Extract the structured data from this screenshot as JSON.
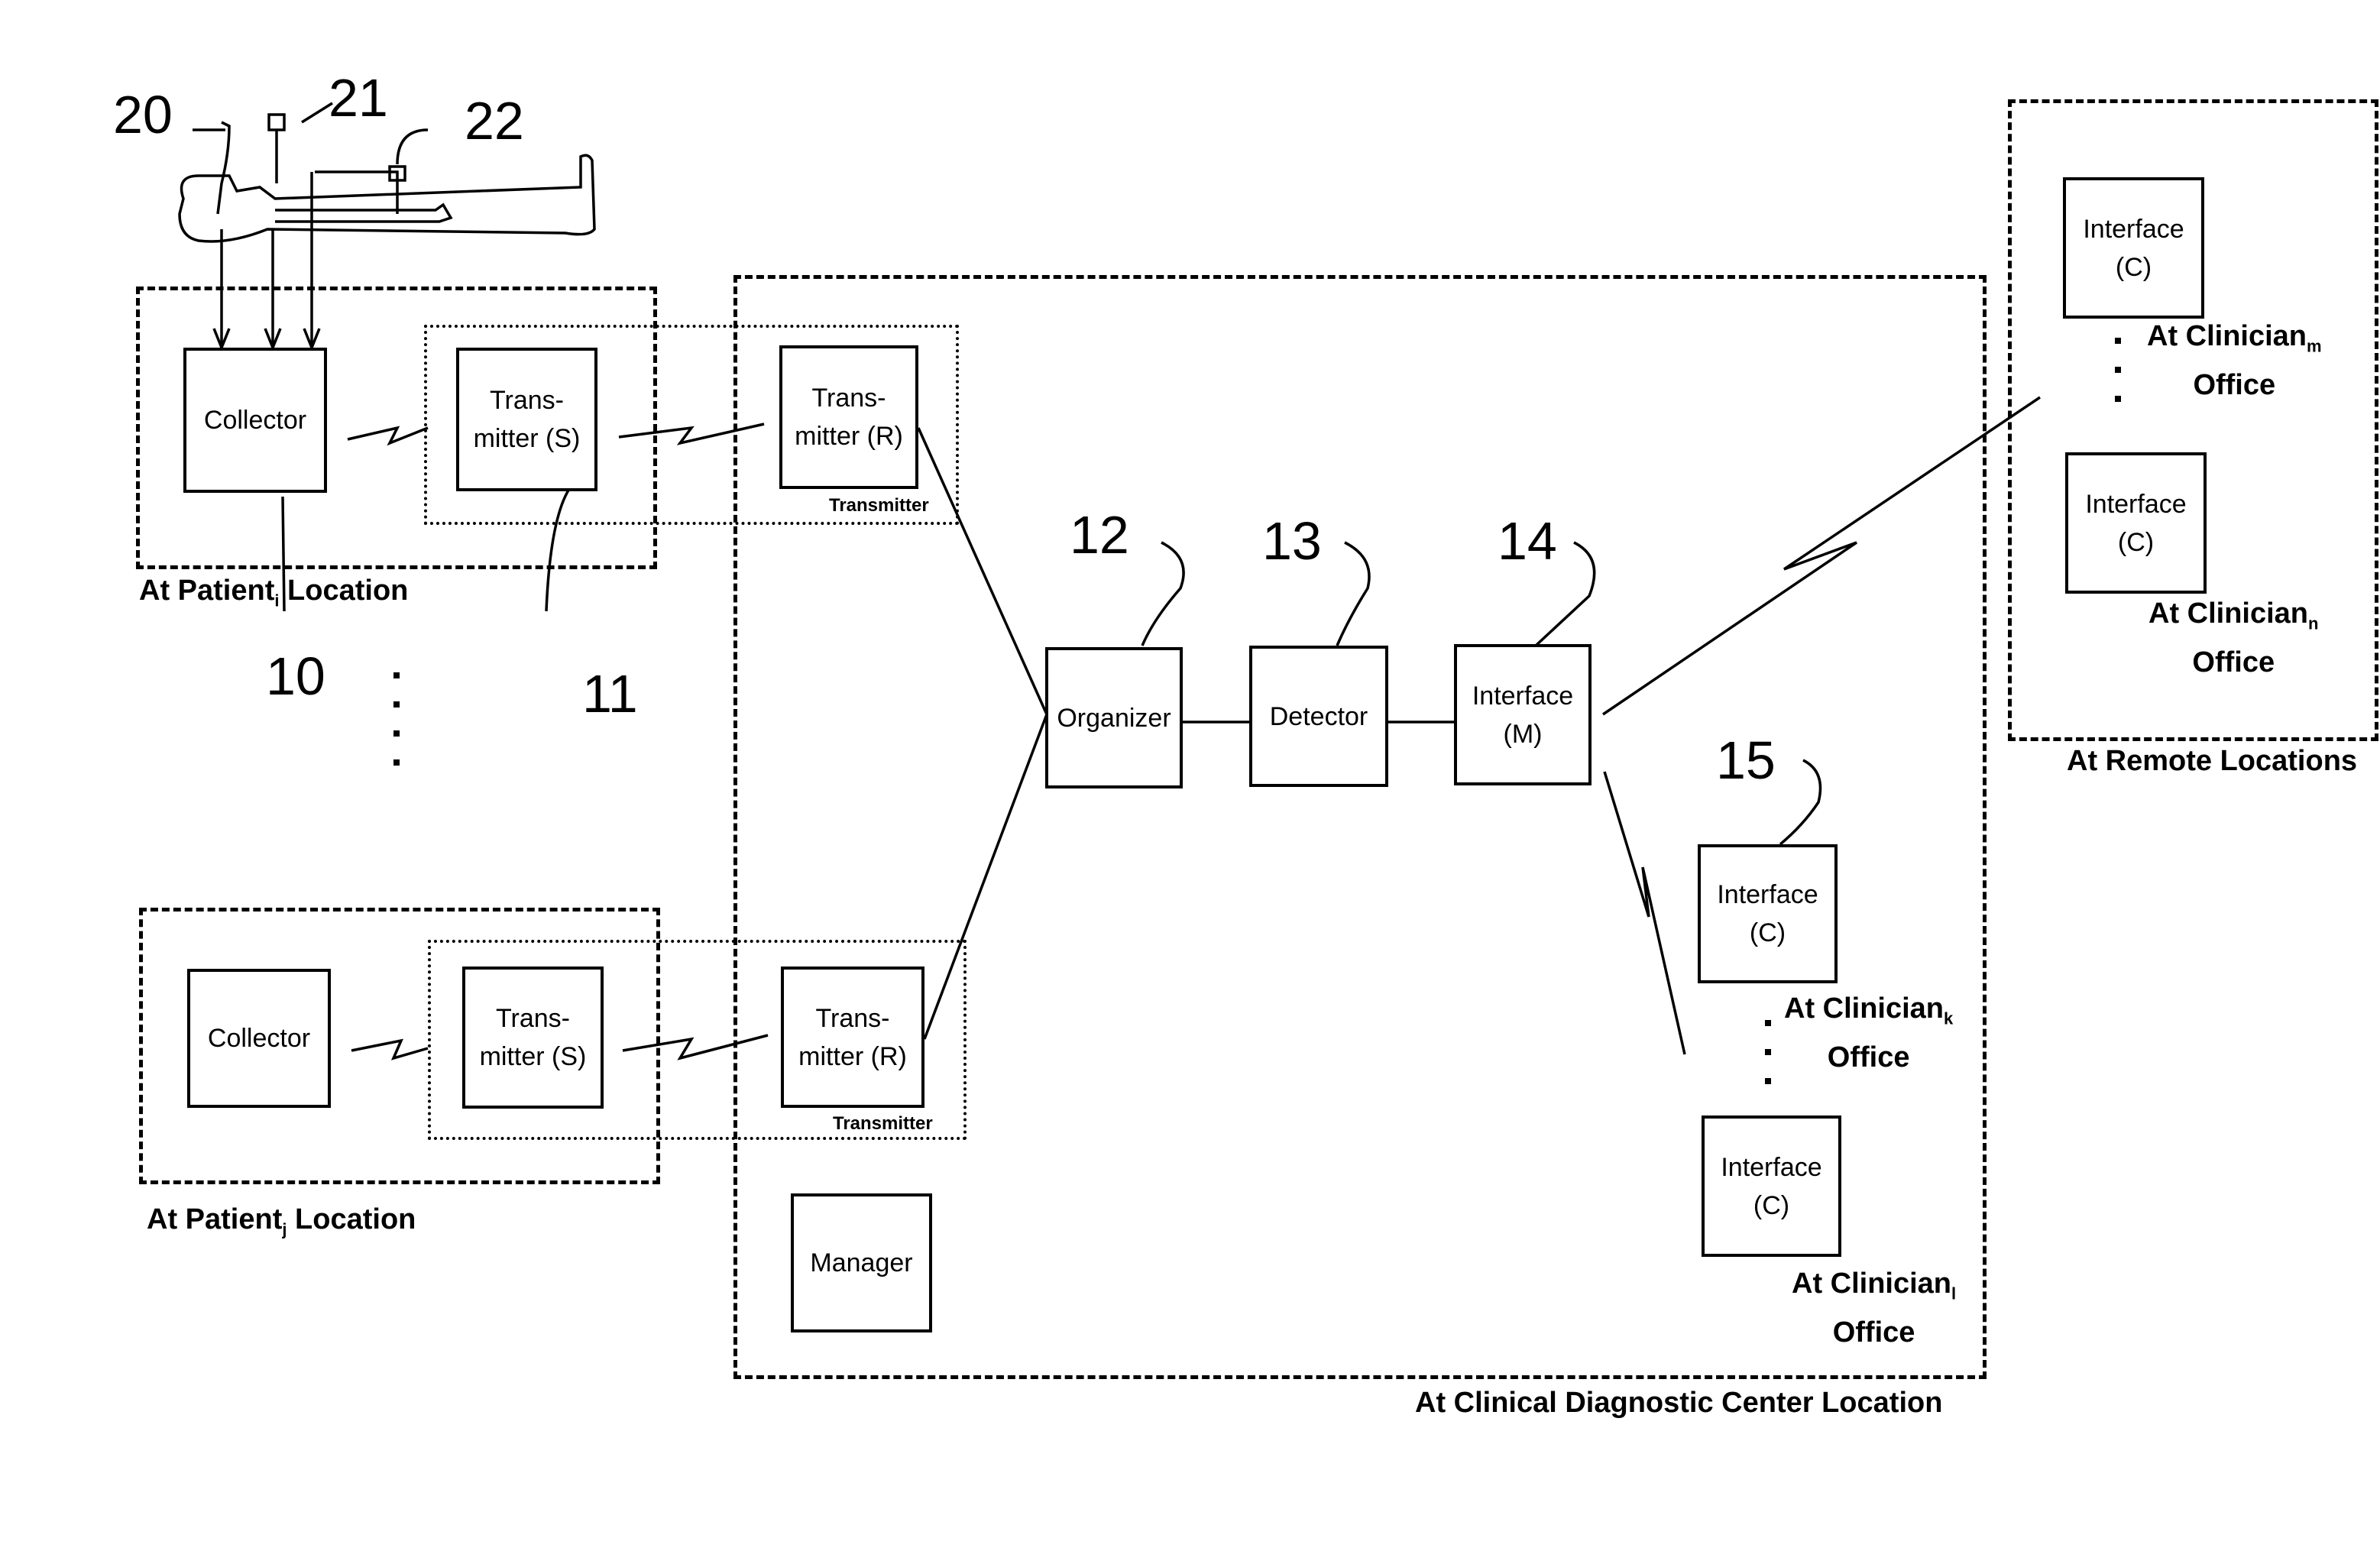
{
  "figure": {
    "ref_numbers": {
      "sensor_head": "20",
      "sensor_chest": "21",
      "sensor_arm": "22",
      "collector": "10",
      "transmitter_s": "11",
      "organizer": "12",
      "detector": "13",
      "interface_m": "14",
      "interface_c": "15"
    },
    "patient_i": {
      "region_label": "At Patient",
      "region_sub": "i",
      "region_suffix": " Location",
      "collector": "Collector",
      "transmitter_s_line1": "Trans-",
      "transmitter_s_line2": "mitter (S)"
    },
    "patient_j": {
      "region_label": "At Patient",
      "region_sub": "j",
      "region_suffix": " Location",
      "collector": "Collector",
      "transmitter_s_line1": "Trans-",
      "transmitter_s_line2": "mitter (S)"
    },
    "center": {
      "region_label": "At Clinical Diagnostic Center Location",
      "transmitter_r_line1": "Trans-",
      "transmitter_r_line2": "mitter (R)",
      "transmitter_group_label": "Transmitter",
      "organizer": "Organizer",
      "detector": "Detector",
      "interface_m_line1": "Interface",
      "interface_m_line2": "(M)",
      "manager": "Manager",
      "interface_c_line1": "Interface",
      "interface_c_line2": "(C)",
      "clinician_k_label": "At Clinician",
      "clinician_k_sub": "k",
      "clinician_l_label": "At Clinician",
      "clinician_l_sub": "l",
      "office": "Office"
    },
    "remote": {
      "region_label": "At Remote Locations",
      "interface_c_line1": "Interface",
      "interface_c_line2": "(C)",
      "clinician_m_label": "At Clinician",
      "clinician_m_sub": "m",
      "clinician_n_label": "At Clinician",
      "clinician_n_sub": "n",
      "office": "Office"
    }
  }
}
